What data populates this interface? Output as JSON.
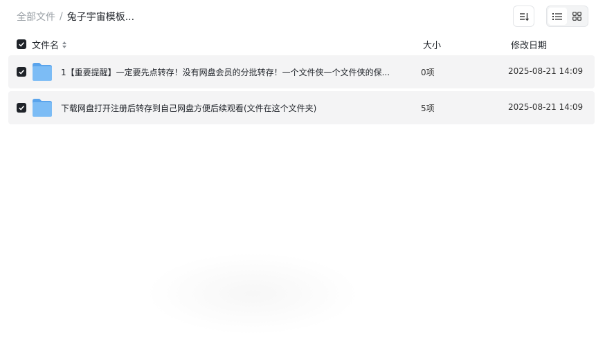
{
  "breadcrumb": {
    "root": "全部文件",
    "separator": "/",
    "current": "兔子宇宙模板..."
  },
  "header": {
    "name_label": "文件名",
    "size_label": "大小",
    "date_label": "修改日期"
  },
  "files": [
    {
      "name": "1【重要提醒】一定要先点转存！没有网盘会员的分批转存！一个文件侠一个文件侠的保...",
      "size": "0项",
      "modified": "2025-08-21 14:09"
    },
    {
      "name": "下载网盘打开注册后转存到自己网盘方便后续观看(文件在这个文件夹)",
      "size": "5项",
      "modified": "2025-08-21 14:09"
    }
  ],
  "colors": {
    "checkbox": "#1f2329",
    "row_bg": "#f4f4f5",
    "folder": "#6fb1f0"
  }
}
